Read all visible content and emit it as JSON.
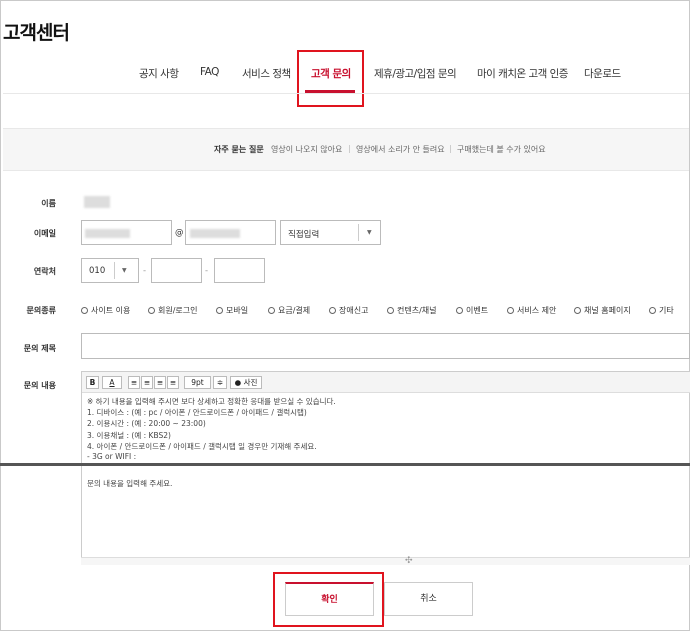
{
  "page": {
    "title": "고객센터"
  },
  "nav": {
    "items": [
      {
        "label": "공지 사항"
      },
      {
        "label": "FAQ"
      },
      {
        "label": "서비스 정책"
      },
      {
        "label": "고객 문의"
      },
      {
        "label": "제휴/광고/입점 문의"
      },
      {
        "label": "마이 캐치온 고객 인증"
      },
      {
        "label": "다운로드"
      }
    ],
    "active_index": 3
  },
  "faq": {
    "title": "자주 묻는 질문",
    "links": [
      "영상이 나오지 않아요",
      "영상에서 소리가 안 들려요",
      "구매했는데 볼 수가 있어요"
    ]
  },
  "form": {
    "name_label": "이름",
    "email_label": "이메일",
    "email_at": "@",
    "email_domain_select": "직접입력",
    "phone_label": "연락처",
    "phone_prefix": "010",
    "phone_dash": "-",
    "type_label": "문의종류",
    "types": [
      "사이트 이용",
      "회원/로그인",
      "모바일",
      "요금/결제",
      "장애신고",
      "컨텐츠/채널",
      "이벤트",
      "서비스 제안",
      "채널 홈페이지",
      "기타"
    ],
    "subject_label": "문의 제목",
    "content_label": "문의 내용"
  },
  "editor": {
    "toolbar": {
      "bold": "B",
      "font_color": "A",
      "font_size": "9pt",
      "photo": "사진"
    },
    "template_lines": [
      "※ 하기 내용을 입력해 주시면 보다 상세하고 정확한 응대를 받으실 수 있습니다.",
      "1. 디바이스 :  (예 : pc / 아이폰 / 안드로이드폰 / 아이패드 / 갤럭시탭)",
      "2. 이용시간 :  (예 : 20:00 ~ 23:00)",
      "3. 이용채널 :  (예 : KBS2)",
      "4. 아이폰 / 안드로이드폰 / 아이패드 / 갤럭시탭 일 경우만 기재해 주세요.",
      "  - 3G or WIFI :"
    ],
    "placeholder_body": "문의 내용을 입력해 주세요."
  },
  "actions": {
    "confirm": "확인",
    "cancel": "취소"
  },
  "colors": {
    "accent": "#c8102e",
    "highlight": "#e0141e"
  }
}
